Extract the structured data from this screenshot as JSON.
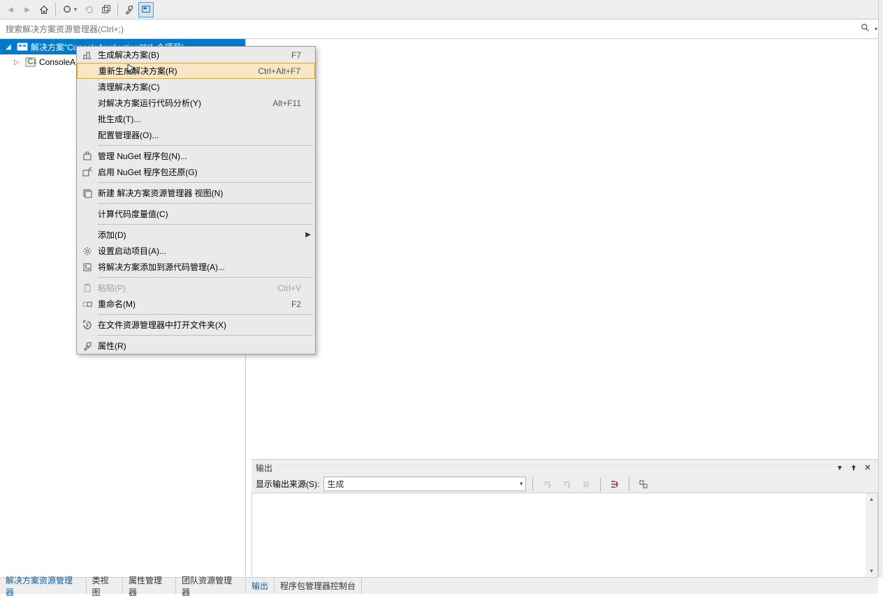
{
  "toolbar": {},
  "search": {
    "placeholder": "搜索解决方案资源管理器(Ctrl+;)"
  },
  "tree": {
    "solution_label": "解决方案\"ConsoleApplication3\"(1 个项目)",
    "project_label": "ConsoleA"
  },
  "context_menu": {
    "items": [
      {
        "icon": "build",
        "label": "生成解决方案(B)",
        "shortcut": "F7"
      },
      {
        "icon": "",
        "label": "重新生成解决方案(R)",
        "shortcut": "Ctrl+Alt+F7",
        "hover": true
      },
      {
        "icon": "",
        "label": "清理解决方案(C)",
        "shortcut": ""
      },
      {
        "icon": "",
        "label": "对解决方案运行代码分析(Y)",
        "shortcut": "Alt+F11"
      },
      {
        "icon": "",
        "label": "批生成(T)...",
        "shortcut": ""
      },
      {
        "icon": "",
        "label": "配置管理器(O)...",
        "shortcut": ""
      },
      {
        "sep": true
      },
      {
        "icon": "nuget",
        "label": "管理 NuGet 程序包(N)...",
        "shortcut": ""
      },
      {
        "icon": "restore",
        "label": "启用 NuGet 程序包还原(G)",
        "shortcut": ""
      },
      {
        "sep": true
      },
      {
        "icon": "newview",
        "label": "新建 解决方案资源管理器 视图(N)",
        "shortcut": ""
      },
      {
        "sep": true
      },
      {
        "icon": "",
        "label": "计算代码度量值(C)",
        "shortcut": ""
      },
      {
        "sep": true
      },
      {
        "icon": "",
        "label": "添加(D)",
        "shortcut": "",
        "submenu": true
      },
      {
        "icon": "gear",
        "label": "设置启动项目(A)...",
        "shortcut": ""
      },
      {
        "icon": "source",
        "label": "将解决方案添加到源代码管理(A)...",
        "shortcut": ""
      },
      {
        "sep": true
      },
      {
        "icon": "paste",
        "label": "粘贴(P)",
        "shortcut": "Ctrl+V",
        "disabled": true
      },
      {
        "icon": "rename",
        "label": "重命名(M)",
        "shortcut": "F2"
      },
      {
        "sep": true
      },
      {
        "icon": "folder",
        "label": "在文件资源管理器中打开文件夹(X)",
        "shortcut": ""
      },
      {
        "sep": true
      },
      {
        "icon": "wrench",
        "label": "属性(R)",
        "shortcut": ""
      }
    ]
  },
  "output": {
    "title": "输出",
    "source_label": "显示输出来源(S):",
    "source_value": "生成"
  },
  "bottom_tabs_left": [
    "解决方案资源管理器",
    "类视图",
    "属性管理器",
    "团队资源管理器"
  ],
  "bottom_tabs_right": [
    "输出",
    "程序包管理器控制台"
  ]
}
